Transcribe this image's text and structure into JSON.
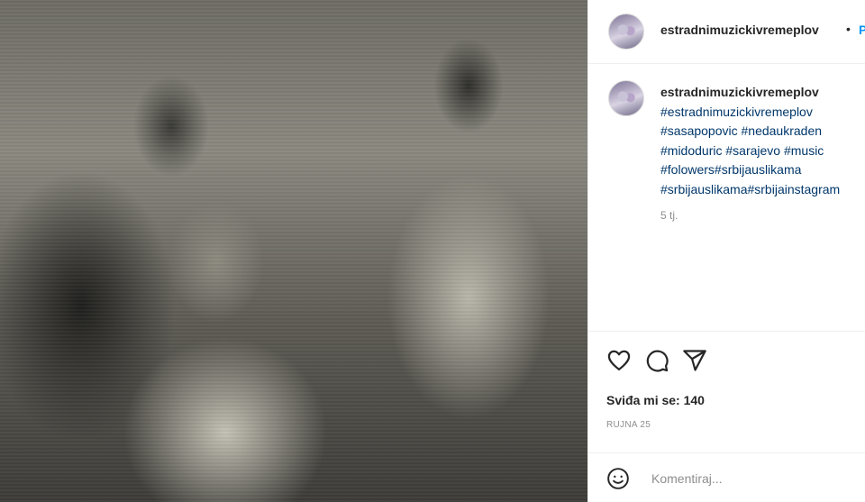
{
  "post": {
    "username": "estradnimuzickivremeplov",
    "separator": "•",
    "follow_label": "P",
    "image_alt": "Black and white photo of three people"
  },
  "caption": {
    "username": "estradnimuzickivremeplov",
    "hashtags": [
      "#estradnimuzickivremeplov",
      "#sasapopovic #nedaukraden",
      "#midoduric #sarajevo #music",
      "#folowers#srbijauslikama",
      "#srbijauslikama#srbijainstagram"
    ],
    "age": "5 tj."
  },
  "actions": {
    "like_icon": "heart-icon",
    "comment_icon": "comment-icon",
    "share_icon": "share-icon"
  },
  "likes_text": "Sviđa mi se: 140",
  "date_text": "RUJNA 25",
  "comment": {
    "placeholder": "Komentiraj...",
    "emoji_icon": "emoji-icon"
  }
}
